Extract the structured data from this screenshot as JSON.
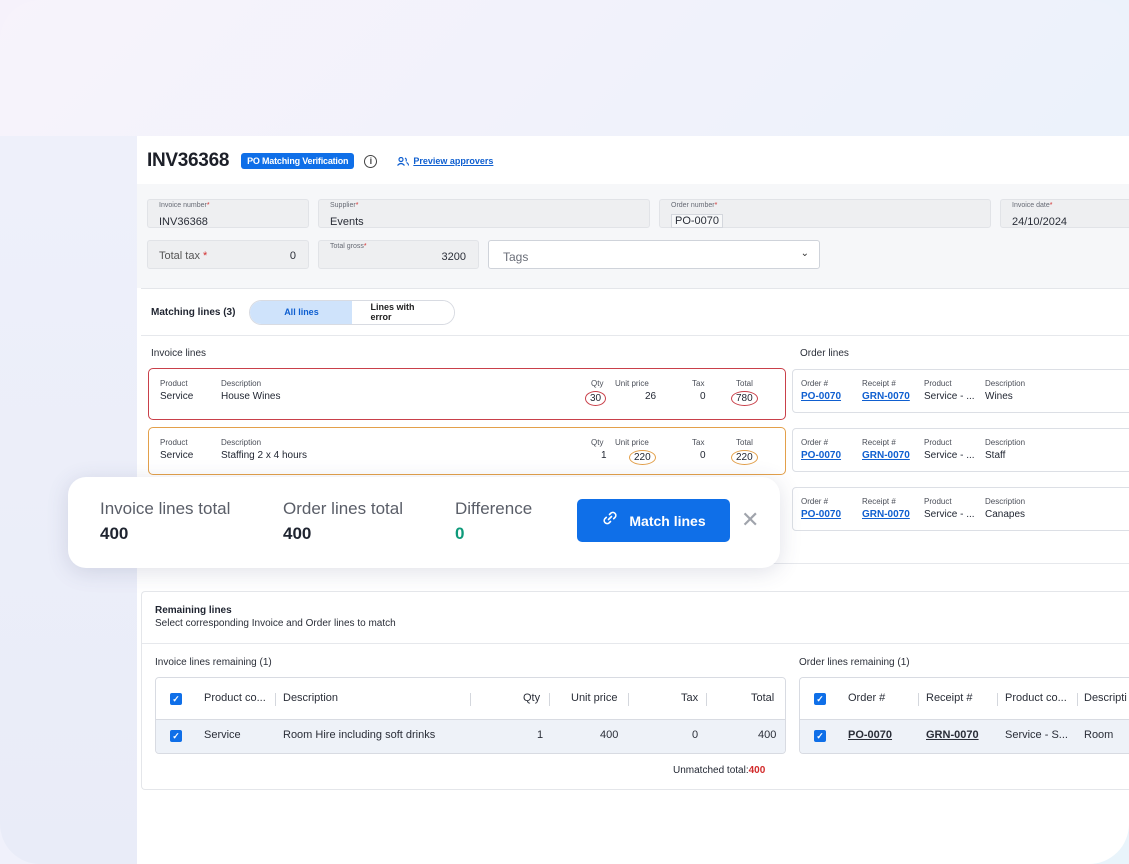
{
  "header": {
    "invoice_id": "INV36368",
    "badge": "PO Matching Verification",
    "preview_link": "Preview approvers"
  },
  "fields": {
    "invoice_number": {
      "label": "Invoice number",
      "value": "INV36368"
    },
    "supplier": {
      "label": "Supplier",
      "value": "Events"
    },
    "order_number": {
      "label": "Order number",
      "value": "PO-0070"
    },
    "invoice_date": {
      "label": "Invoice date",
      "value": "24/10/2024"
    },
    "total_tax": {
      "label": "Total tax",
      "value": "0"
    },
    "total_gross": {
      "label": "Total gross",
      "value": "3200"
    },
    "tags": {
      "placeholder": "Tags"
    }
  },
  "matching": {
    "title": "Matching lines (3)",
    "tabs": [
      "All lines",
      "Lines with error"
    ],
    "invoice_section": "Invoice lines",
    "order_section": "Order lines",
    "columns": {
      "product": "Product",
      "description": "Description",
      "qty": "Qty",
      "unit_price": "Unit price",
      "tax": "Tax",
      "total": "Total",
      "order": "Order #",
      "receipt": "Receipt #"
    },
    "invoice_lines": [
      {
        "product": "Service",
        "description": "House Wines",
        "qty": "30",
        "unit_price": "26",
        "tax": "0",
        "total": "780"
      },
      {
        "product": "Service",
        "description": "Staffing 2 x 4 hours",
        "qty": "1",
        "unit_price": "220",
        "tax": "0",
        "total": "220"
      }
    ],
    "order_lines": [
      {
        "order": "PO-0070",
        "receipt": "GRN-0070",
        "product": "Service - ...",
        "description": "Wines"
      },
      {
        "order": "PO-0070",
        "receipt": "GRN-0070",
        "product": "Service - ...",
        "description": "Staff"
      },
      {
        "order": "PO-0070",
        "receipt": "GRN-0070",
        "product": "Service - ...",
        "description": "Canapes"
      }
    ]
  },
  "totals": {
    "invoice_label": "Invoice lines total",
    "invoice_value": "400",
    "order_label": "Order lines total",
    "order_value": "400",
    "difference_label": "Difference",
    "difference_value": "0",
    "match_button": "Match lines",
    "close_glyph": "✕"
  },
  "remaining": {
    "title": "Remaining lines",
    "subtitle": "Select corresponding Invoice and Order lines to match",
    "invoice_title": "Invoice lines remaining (1)",
    "order_title": "Order lines remaining (1)",
    "invoice_headers": [
      "Product co...",
      "Description",
      "Qty",
      "Unit price",
      "Tax",
      "Total"
    ],
    "invoice_row": {
      "product": "Service",
      "description": "Room Hire including soft drinks",
      "qty": "1",
      "unit_price": "400",
      "tax": "0",
      "total": "400"
    },
    "order_headers": [
      "Order #",
      "Receipt #",
      "Product co...",
      "Descripti"
    ],
    "order_row": {
      "order": "PO-0070",
      "receipt": "GRN-0070",
      "product": "Service - S...",
      "description": "Room"
    },
    "unmatched_label": "Unmatched total:",
    "unmatched_value": "400"
  },
  "colors": {
    "accent": "#0f6fe8",
    "error": "#c9404a",
    "warning": "#e3a04a",
    "success": "#0e9a7a"
  }
}
